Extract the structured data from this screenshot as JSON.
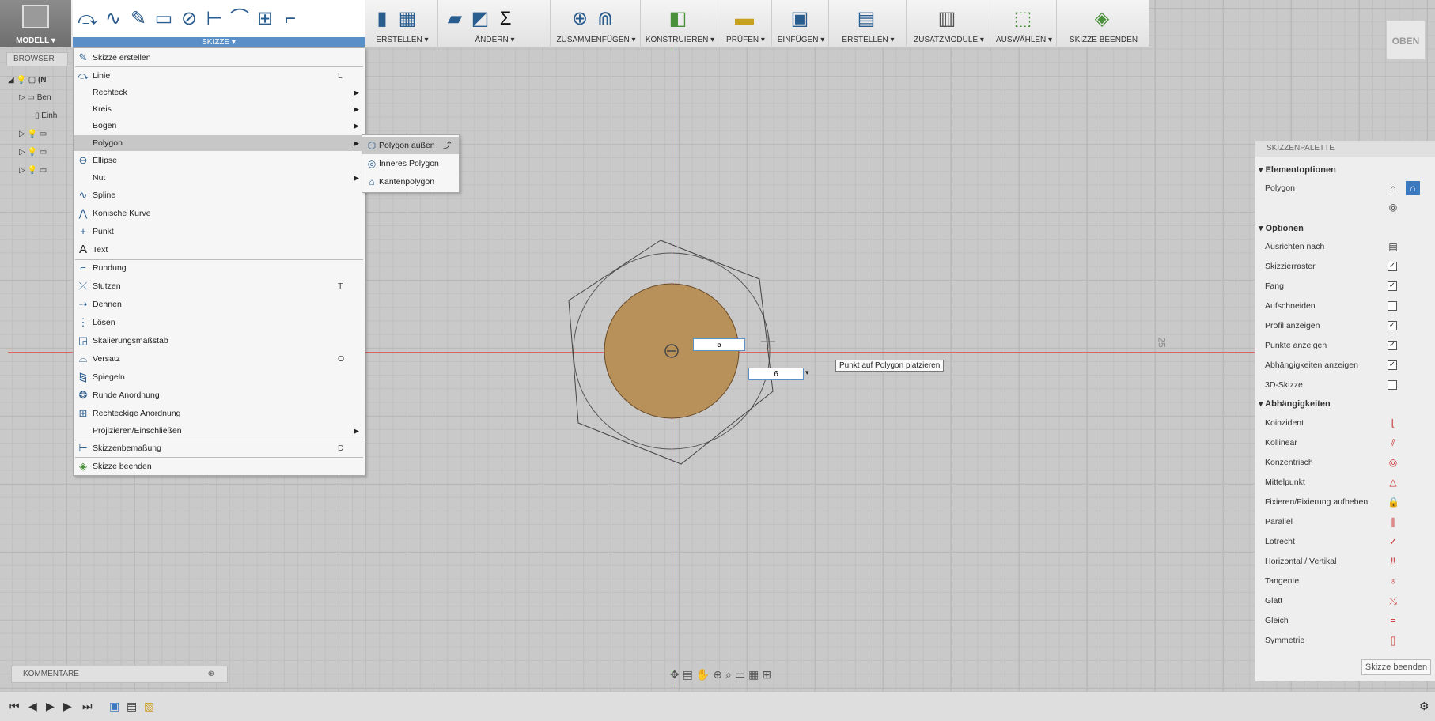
{
  "toolbar": {
    "mode_label": "MODELL ▾",
    "skizze_label": "SKIZZE ▾",
    "groups": [
      {
        "label": "ERSTELLEN ▾"
      },
      {
        "label": "ÄNDERN ▾"
      },
      {
        "label": "ZUSAMMENFÜGEN ▾"
      },
      {
        "label": "KONSTRUIEREN ▾"
      },
      {
        "label": "PRÜFEN ▾"
      },
      {
        "label": "EINFÜGEN ▾"
      },
      {
        "label": "ERSTELLEN ▾"
      },
      {
        "label": "ZUSATZMODULE ▾"
      },
      {
        "label": "AUSWÄHLEN ▾"
      },
      {
        "label": "SKIZZE BEENDEN"
      }
    ],
    "view_cube_label": "OBEN"
  },
  "browser": {
    "tab_label": "BROWSER",
    "row1_label": "(N",
    "row2_label": "Ben",
    "row3_label": "Einh"
  },
  "sketch_menu": {
    "items": [
      {
        "label": "Skizze erstellen",
        "shortcut": "",
        "icon": "sketch-create-icon"
      },
      {
        "label": "Linie",
        "shortcut": "L",
        "icon": "line-icon"
      },
      {
        "label": "Rechteck",
        "shortcut": "",
        "icon": "",
        "submenu": true
      },
      {
        "label": "Kreis",
        "shortcut": "",
        "icon": "",
        "submenu": true
      },
      {
        "label": "Bogen",
        "shortcut": "",
        "icon": "",
        "submenu": true
      },
      {
        "label": "Polygon",
        "shortcut": "",
        "icon": "",
        "submenu": true
      },
      {
        "label": "Ellipse",
        "shortcut": "",
        "icon": "ellipse-icon"
      },
      {
        "label": "Nut",
        "shortcut": "",
        "icon": "",
        "submenu": true
      },
      {
        "label": "Spline",
        "shortcut": "",
        "icon": "spline-icon"
      },
      {
        "label": "Konische Kurve",
        "shortcut": "",
        "icon": "conic-curve-icon"
      },
      {
        "label": "Punkt",
        "shortcut": "",
        "icon": "point-icon"
      },
      {
        "label": "Text",
        "shortcut": "",
        "icon": "text-icon"
      },
      {
        "label": "Rundung",
        "shortcut": "",
        "icon": "fillet-icon"
      },
      {
        "label": "Stutzen",
        "shortcut": "T",
        "icon": "trim-icon"
      },
      {
        "label": "Dehnen",
        "shortcut": "",
        "icon": "extend-icon"
      },
      {
        "label": "Lösen",
        "shortcut": "",
        "icon": "break-icon"
      },
      {
        "label": "Skalierungsmaßstab",
        "shortcut": "",
        "icon": "scale-icon"
      },
      {
        "label": "Versatz",
        "shortcut": "O",
        "icon": "offset-icon"
      },
      {
        "label": "Spiegeln",
        "shortcut": "",
        "icon": "mirror-icon"
      },
      {
        "label": "Runde Anordnung",
        "shortcut": "",
        "icon": "circular-pattern-icon"
      },
      {
        "label": "Rechteckige Anordnung",
        "shortcut": "",
        "icon": "rectangular-pattern-icon"
      },
      {
        "label": "Projizieren/Einschließen",
        "shortcut": "",
        "icon": "",
        "submenu": true
      },
      {
        "label": "Skizzenbemaßung",
        "shortcut": "D",
        "icon": "dimension-icon"
      },
      {
        "label": "Skizze beenden",
        "shortcut": "",
        "icon": "finish-sketch-icon"
      }
    ]
  },
  "polygon_submenu": {
    "items": [
      {
        "label": "Polygon außen"
      },
      {
        "label": "Inneres Polygon"
      },
      {
        "label": "Kantenpolygon"
      }
    ]
  },
  "canvas": {
    "dim_input_1": "5",
    "dim_input_2": "6",
    "tooltip": "Punkt auf Polygon platzieren",
    "ruler_label": "25",
    "profile_fill_color": "#b8905a"
  },
  "palette": {
    "title": "SKIZZENPALETTE",
    "section_element": "▾ Elementoptionen",
    "polygon_label": "Polygon",
    "section_options": "▾ Optionen",
    "options": [
      {
        "label": "Ausrichten nach",
        "checked": null
      },
      {
        "label": "Skizzierraster",
        "checked": true
      },
      {
        "label": "Fang",
        "checked": true
      },
      {
        "label": "Aufschneiden",
        "checked": false
      },
      {
        "label": "Profil anzeigen",
        "checked": true
      },
      {
        "label": "Punkte anzeigen",
        "checked": true
      },
      {
        "label": "Abhängigkeiten anzeigen",
        "checked": true
      },
      {
        "label": "3D-Skizze",
        "checked": false
      }
    ],
    "section_constraints": "▾ Abhängigkeiten",
    "constraints": [
      {
        "label": "Koinzident",
        "icon": "coincident-icon"
      },
      {
        "label": "Kollinear",
        "icon": "collinear-icon"
      },
      {
        "label": "Konzentrisch",
        "icon": "concentric-icon"
      },
      {
        "label": "Mittelpunkt",
        "icon": "midpoint-icon"
      },
      {
        "label": "Fixieren/Fixierung aufheben",
        "icon": "fix-icon"
      },
      {
        "label": "Parallel",
        "icon": "parallel-icon"
      },
      {
        "label": "Lotrecht",
        "icon": "perpendicular-icon"
      },
      {
        "label": "Horizontal / Vertikal",
        "icon": "horizontal-vertical-icon"
      },
      {
        "label": "Tangente",
        "icon": "tangent-icon"
      },
      {
        "label": "Glatt",
        "icon": "smooth-icon"
      },
      {
        "label": "Gleich",
        "icon": "equal-icon"
      },
      {
        "label": "Symmetrie",
        "icon": "symmetry-icon"
      }
    ],
    "finish_button": "Skizze beenden"
  },
  "bottom": {
    "comments_label": "KOMMENTARE"
  }
}
